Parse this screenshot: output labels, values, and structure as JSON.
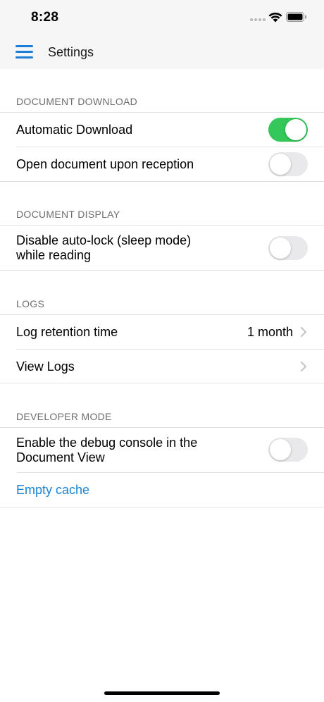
{
  "status_bar": {
    "time": "8:28",
    "icons": [
      "signal-dots-icon",
      "wifi-icon",
      "battery-icon"
    ]
  },
  "nav": {
    "menu_icon": "hamburger-menu-icon",
    "title": "Settings",
    "accent_color": "#1c7ed6"
  },
  "sections": {
    "document_download": {
      "header": "DOCUMENT DOWNLOAD",
      "automatic_download": {
        "label": "Automatic Download",
        "enabled": true
      },
      "open_on_reception": {
        "label": "Open document upon reception",
        "enabled": false
      }
    },
    "document_display": {
      "header": "DOCUMENT DISPLAY",
      "disable_autolock": {
        "label_line1": "Disable auto-lock (sleep mode)",
        "label_line2": "while reading",
        "enabled": false
      }
    },
    "logs": {
      "header": "LOGS",
      "retention": {
        "label": "Log retention time",
        "value": "1 month"
      },
      "view_logs": {
        "label": "View Logs"
      }
    },
    "developer_mode": {
      "header": "DEVELOPER MODE",
      "debug_console": {
        "label_line1": "Enable the debug console in the",
        "label_line2": "Document View",
        "enabled": false
      },
      "empty_cache": {
        "label": "Empty cache",
        "color": "#1a84d4"
      }
    }
  },
  "colors": {
    "toggle_on": "#34c759",
    "toggle_off": "#e9e9eb",
    "section_header": "#6d6d72"
  }
}
